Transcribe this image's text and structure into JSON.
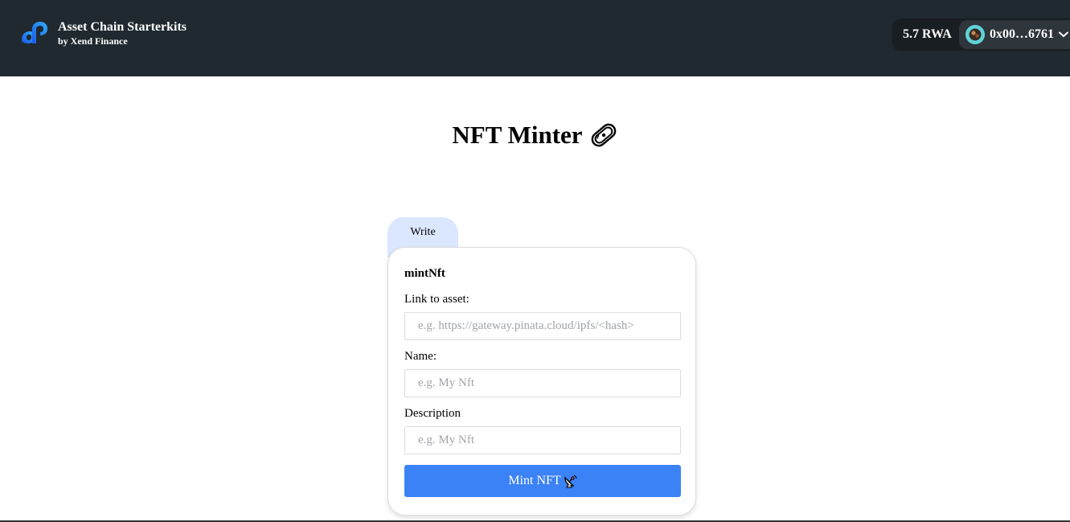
{
  "header": {
    "brand_title": "Asset Chain Starterkits",
    "brand_subtitle": "by Xend Finance",
    "balance": "5.7 RWA",
    "address": "0x00…6761"
  },
  "main": {
    "title": "NFT Minter",
    "tab_label": "Write",
    "function_name": "mintNft",
    "fields": [
      {
        "label": "Link to asset:",
        "placeholder": "e.g. https://gateway.pinata.cloud/ipfs/<hash>",
        "value": ""
      },
      {
        "label": "Name:",
        "placeholder": "e.g. My Nft",
        "value": ""
      },
      {
        "label": "Description",
        "placeholder": "e.g. My Nft",
        "value": ""
      }
    ],
    "submit_label": "Mint NFT"
  },
  "colors": {
    "header_bg": "#1f292f",
    "tab_bg": "#dbe7fe",
    "button_bg": "#3b82f6",
    "avatar_bg": "#5ed3d8"
  },
  "icons": {
    "brand": "asset-chain-logo-icon",
    "title_emoji": "disc-emoji-icon",
    "button_emoji": "satellite-antenna-emoji-icon",
    "account_chevron": "chevron-down-icon"
  }
}
